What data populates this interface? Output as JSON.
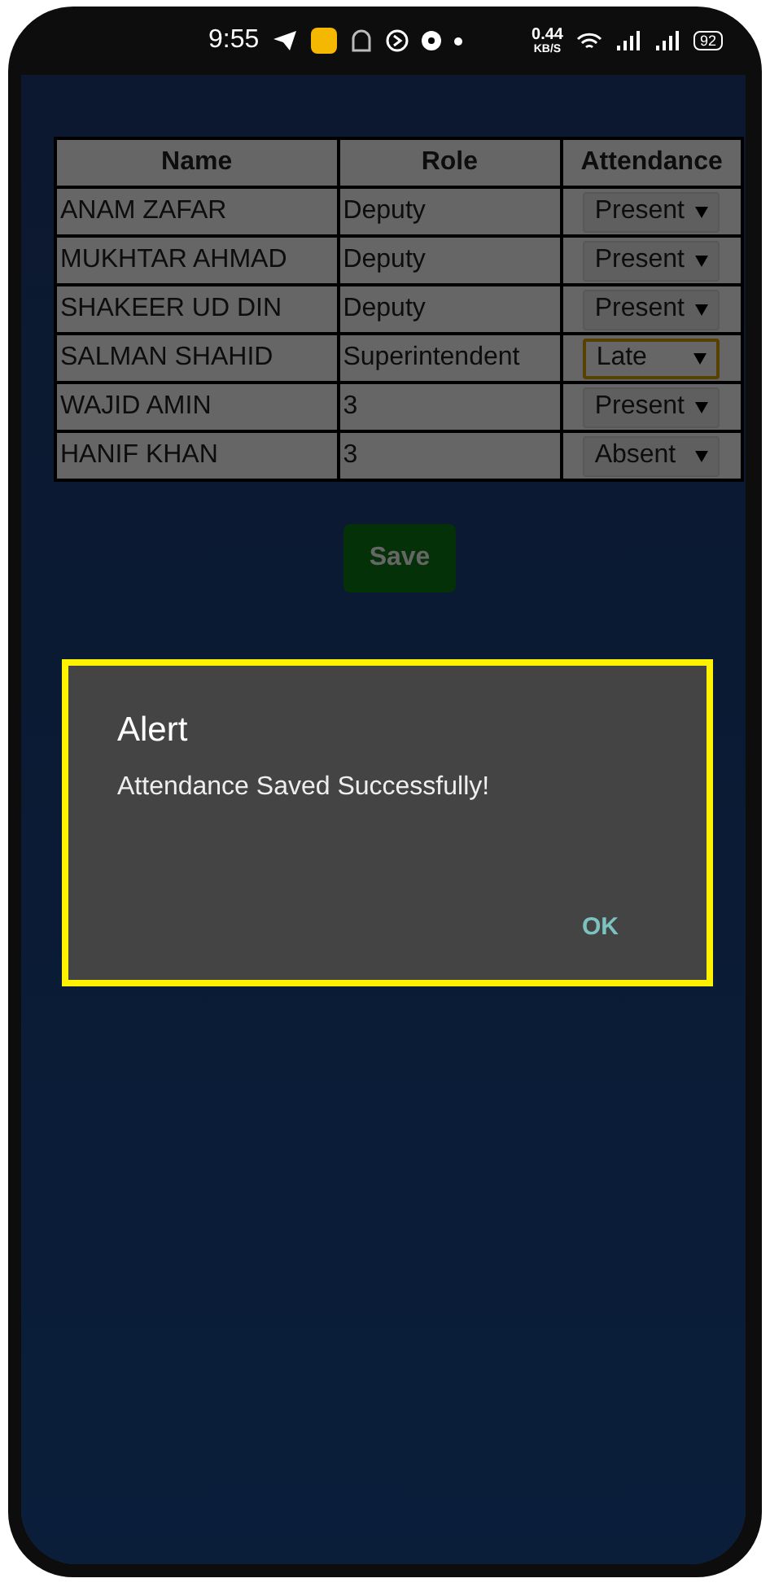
{
  "status_bar": {
    "time": "9:55",
    "speed": "0.44",
    "speed_unit": "KB/S",
    "battery": "92"
  },
  "table": {
    "columns": [
      "Name",
      "Role",
      "Attendance"
    ],
    "rows": [
      {
        "name": "ANAM ZAFAR",
        "role": "Deputy",
        "attendance": "Present",
        "focused": false
      },
      {
        "name": "MUKHTAR AHMAD",
        "role": "Deputy",
        "attendance": "Present",
        "focused": false
      },
      {
        "name": "SHAKEER UD DIN",
        "role": "Deputy",
        "attendance": "Present",
        "focused": false
      },
      {
        "name": "SALMAN SHAHID",
        "role": "Superintendent",
        "attendance": "Late",
        "focused": true
      },
      {
        "name": "WAJID AMIN",
        "role": "3",
        "attendance": "Present",
        "focused": false
      },
      {
        "name": "HANIF KHAN",
        "role": "3",
        "attendance": "Absent",
        "focused": false
      }
    ]
  },
  "save_button": "Save",
  "dialog": {
    "title": "Alert",
    "message": "Attendance Saved Successfully!",
    "button": "OK"
  }
}
